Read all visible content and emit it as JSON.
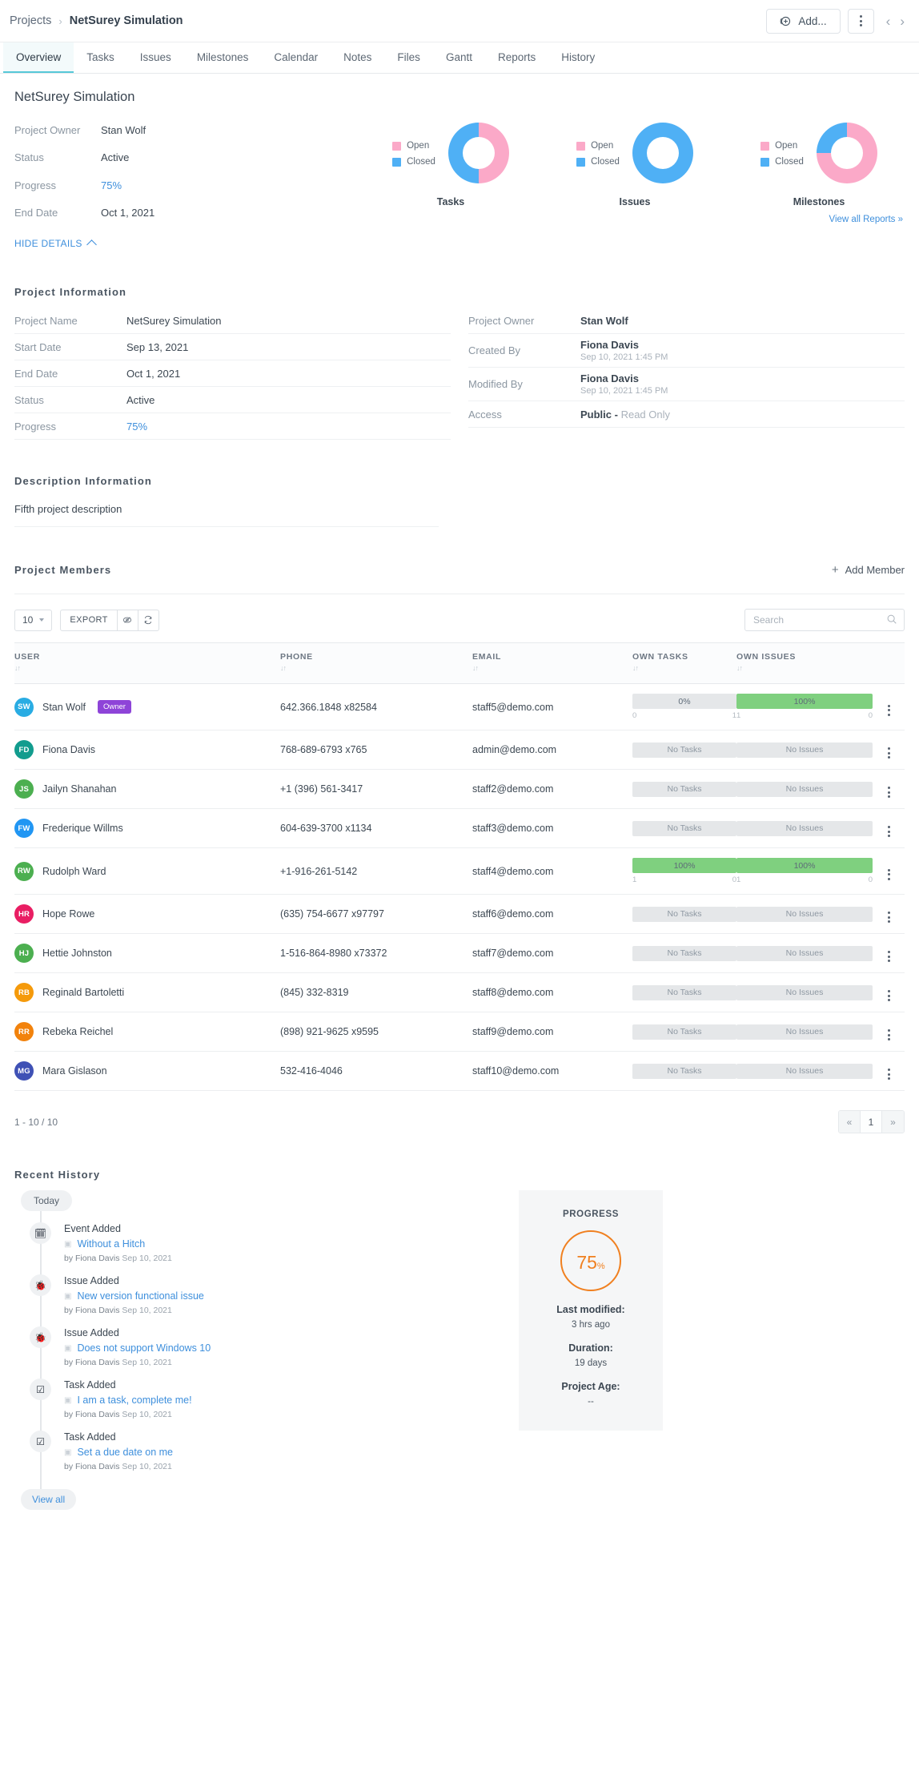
{
  "header": {
    "breadcrumb_root": "Projects",
    "breadcrumb_sep": "›",
    "breadcrumb_current": "NetSurey Simulation",
    "add_label": "Add...",
    "prev_glyph": "‹",
    "next_glyph": "›"
  },
  "tabs": [
    {
      "label": "Overview",
      "active": true
    },
    {
      "label": "Tasks",
      "active": false
    },
    {
      "label": "Issues",
      "active": false
    },
    {
      "label": "Milestones",
      "active": false
    },
    {
      "label": "Calendar",
      "active": false
    },
    {
      "label": "Notes",
      "active": false
    },
    {
      "label": "Files",
      "active": false
    },
    {
      "label": "Gantt",
      "active": false
    },
    {
      "label": "Reports",
      "active": false
    },
    {
      "label": "History",
      "active": false
    }
  ],
  "summary": {
    "project_title": "NetSurey Simulation",
    "rows": [
      {
        "label": "Project Owner",
        "value": "Stan Wolf",
        "link": false
      },
      {
        "label": "Status",
        "value": "Active",
        "link": false
      },
      {
        "label": "Progress",
        "value": "75%",
        "link": true
      },
      {
        "label": "End Date",
        "value": "Oct 1, 2021",
        "link": false
      }
    ],
    "hide_details": "HIDE DETAILS",
    "view_all_reports": "View all Reports »"
  },
  "chart_data": [
    {
      "type": "pie",
      "title": "Tasks",
      "legend": [
        "Open",
        "Closed"
      ],
      "categories": [
        "Open",
        "Closed"
      ],
      "values": [
        50,
        50
      ],
      "colors": [
        "#fba9c8",
        "#4fb0f5"
      ],
      "legend_position": "left"
    },
    {
      "type": "pie",
      "title": "Issues",
      "legend": [
        "Open",
        "Closed"
      ],
      "categories": [
        "Open",
        "Closed"
      ],
      "values": [
        0,
        100
      ],
      "colors": [
        "#fba9c8",
        "#4fb0f5"
      ],
      "legend_position": "left"
    },
    {
      "type": "pie",
      "title": "Milestones",
      "legend": [
        "Open",
        "Closed"
      ],
      "categories": [
        "Open",
        "Closed"
      ],
      "values": [
        75,
        25
      ],
      "colors": [
        "#fba9c8",
        "#4fb0f5"
      ],
      "legend_position": "left"
    }
  ],
  "project_information": {
    "title": "Project Information",
    "left": [
      {
        "label": "Project Name",
        "value": "NetSurey Simulation",
        "link": false
      },
      {
        "label": "Start Date",
        "value": "Sep 13, 2021",
        "link": false
      },
      {
        "label": "End Date",
        "value": "Oct 1, 2021",
        "link": false
      },
      {
        "label": "Status",
        "value": "Active",
        "link": false
      },
      {
        "label": "Progress",
        "value": "75%",
        "link": true
      }
    ],
    "right": [
      {
        "label": "Project Owner",
        "value": "Stan Wolf",
        "sub": "",
        "muted": ""
      },
      {
        "label": "Created By",
        "value": "Fiona Davis",
        "sub": "Sep 10, 2021 1:45 PM",
        "muted": ""
      },
      {
        "label": "Modified By",
        "value": "Fiona Davis",
        "sub": "Sep 10, 2021 1:45 PM",
        "muted": ""
      },
      {
        "label": "Access",
        "value": "Public -",
        "sub": "",
        "muted": "Read Only"
      }
    ]
  },
  "description": {
    "title": "Description Information",
    "text": "Fifth project description"
  },
  "members": {
    "title": "Project Members",
    "add_member": "Add Member",
    "page_size": "10",
    "export_label": "EXPORT",
    "search_placeholder": "Search",
    "search_value": "",
    "columns": [
      "USER",
      "PHONE",
      "EMAIL",
      "OWN TASKS",
      "OWN ISSUES"
    ],
    "rows": [
      {
        "initials": "SW",
        "avatar_color": "#29ace3",
        "name": "Stan Wolf",
        "badge": "Owner",
        "phone": "642.366.1848 x82584",
        "email": "staff5@demo.com",
        "tasks": {
          "type": "bar",
          "percent": "0%",
          "fill": 0,
          "left": "0",
          "right": "1"
        },
        "issues": {
          "type": "bar",
          "percent": "100%",
          "fill": 100,
          "left": "1",
          "right": "0"
        }
      },
      {
        "initials": "FD",
        "avatar_color": "#129c8e",
        "name": "Fiona Davis",
        "badge": "",
        "phone": "768-689-6793 x765",
        "email": "admin@demo.com",
        "tasks": {
          "type": "none",
          "percent": "No Tasks"
        },
        "issues": {
          "type": "none",
          "percent": "No Issues"
        }
      },
      {
        "initials": "JS",
        "avatar_color": "#4caf50",
        "name": "Jailyn Shanahan",
        "badge": "",
        "phone": "+1 (396) 561-3417",
        "email": "staff2@demo.com",
        "tasks": {
          "type": "none",
          "percent": "No Tasks"
        },
        "issues": {
          "type": "none",
          "percent": "No Issues"
        }
      },
      {
        "initials": "FW",
        "avatar_color": "#2196f3",
        "name": "Frederique Willms",
        "badge": "",
        "phone": "604-639-3700 x1134",
        "email": "staff3@demo.com",
        "tasks": {
          "type": "none",
          "percent": "No Tasks"
        },
        "issues": {
          "type": "none",
          "percent": "No Issues"
        }
      },
      {
        "initials": "RW",
        "avatar_color": "#4caf50",
        "name": "Rudolph Ward",
        "badge": "",
        "phone": "+1-916-261-5142",
        "email": "staff4@demo.com",
        "tasks": {
          "type": "bar",
          "percent": "100%",
          "fill": 100,
          "left": "1",
          "right": "0"
        },
        "issues": {
          "type": "bar",
          "percent": "100%",
          "fill": 100,
          "left": "1",
          "right": "0"
        }
      },
      {
        "initials": "HR",
        "avatar_color": "#e91e63",
        "name": "Hope Rowe",
        "badge": "",
        "phone": "(635) 754-6677 x97797",
        "email": "staff6@demo.com",
        "tasks": {
          "type": "none",
          "percent": "No Tasks"
        },
        "issues": {
          "type": "none",
          "percent": "No Issues"
        }
      },
      {
        "initials": "HJ",
        "avatar_color": "#4caf50",
        "name": "Hettie Johnston",
        "badge": "",
        "phone": "1-516-864-8980 x73372",
        "email": "staff7@demo.com",
        "tasks": {
          "type": "none",
          "percent": "No Tasks"
        },
        "issues": {
          "type": "none",
          "percent": "No Issues"
        }
      },
      {
        "initials": "RB",
        "avatar_color": "#f59a0b",
        "name": "Reginald Bartoletti",
        "badge": "",
        "phone": "(845) 332-8319",
        "email": "staff8@demo.com",
        "tasks": {
          "type": "none",
          "percent": "No Tasks"
        },
        "issues": {
          "type": "none",
          "percent": "No Issues"
        }
      },
      {
        "initials": "RR",
        "avatar_color": "#f2820c",
        "name": "Rebeka Reichel",
        "badge": "",
        "phone": "(898) 921-9625 x9595",
        "email": "staff9@demo.com",
        "tasks": {
          "type": "none",
          "percent": "No Tasks"
        },
        "issues": {
          "type": "none",
          "percent": "No Issues"
        }
      },
      {
        "initials": "MG",
        "avatar_color": "#3f51b5",
        "name": "Mara Gislason",
        "badge": "",
        "phone": "532-416-4046",
        "email": "staff10@demo.com",
        "tasks": {
          "type": "none",
          "percent": "No Tasks"
        },
        "issues": {
          "type": "none",
          "percent": "No Issues"
        }
      }
    ],
    "pagination_count": "1 - 10 / 10",
    "page_prev": "«",
    "page_current": "1",
    "page_next": "»"
  },
  "history": {
    "title": "Recent History",
    "today_label": "Today",
    "view_all": "View all",
    "items": [
      {
        "kind": "Event Added",
        "icon": "calendar-icon",
        "glyph": "🗓",
        "link": "Without a Hitch",
        "meta_by": "by Fiona Davis ",
        "meta_date": "Sep 10, 2021"
      },
      {
        "kind": "Issue Added",
        "icon": "bug-icon",
        "glyph": "🐞",
        "link": "New version functional issue",
        "meta_by": "by Fiona Davis ",
        "meta_date": "Sep 10, 2021"
      },
      {
        "kind": "Issue Added",
        "icon": "bug-icon",
        "glyph": "🐞",
        "link": "Does not support Windows 10",
        "meta_by": "by Fiona Davis ",
        "meta_date": "Sep 10, 2021"
      },
      {
        "kind": "Task Added",
        "icon": "clipboard-check-icon",
        "glyph": "☑",
        "link": "I am a task, complete me!",
        "meta_by": "by Fiona Davis ",
        "meta_date": "Sep 10, 2021"
      },
      {
        "kind": "Task Added",
        "icon": "clipboard-check-icon",
        "glyph": "☑",
        "link": "Set a due date on me",
        "meta_by": "by Fiona Davis ",
        "meta_date": "Sep 10, 2021"
      }
    ]
  },
  "progress_card": {
    "title": "PROGRESS",
    "percent_number": "75",
    "percent_symbol": "%",
    "last_modified_label": "Last modified:",
    "last_modified_value": "3 hrs ago",
    "duration_label": "Duration:",
    "duration_value": "19 days",
    "age_label": "Project Age:",
    "age_value": "--"
  }
}
